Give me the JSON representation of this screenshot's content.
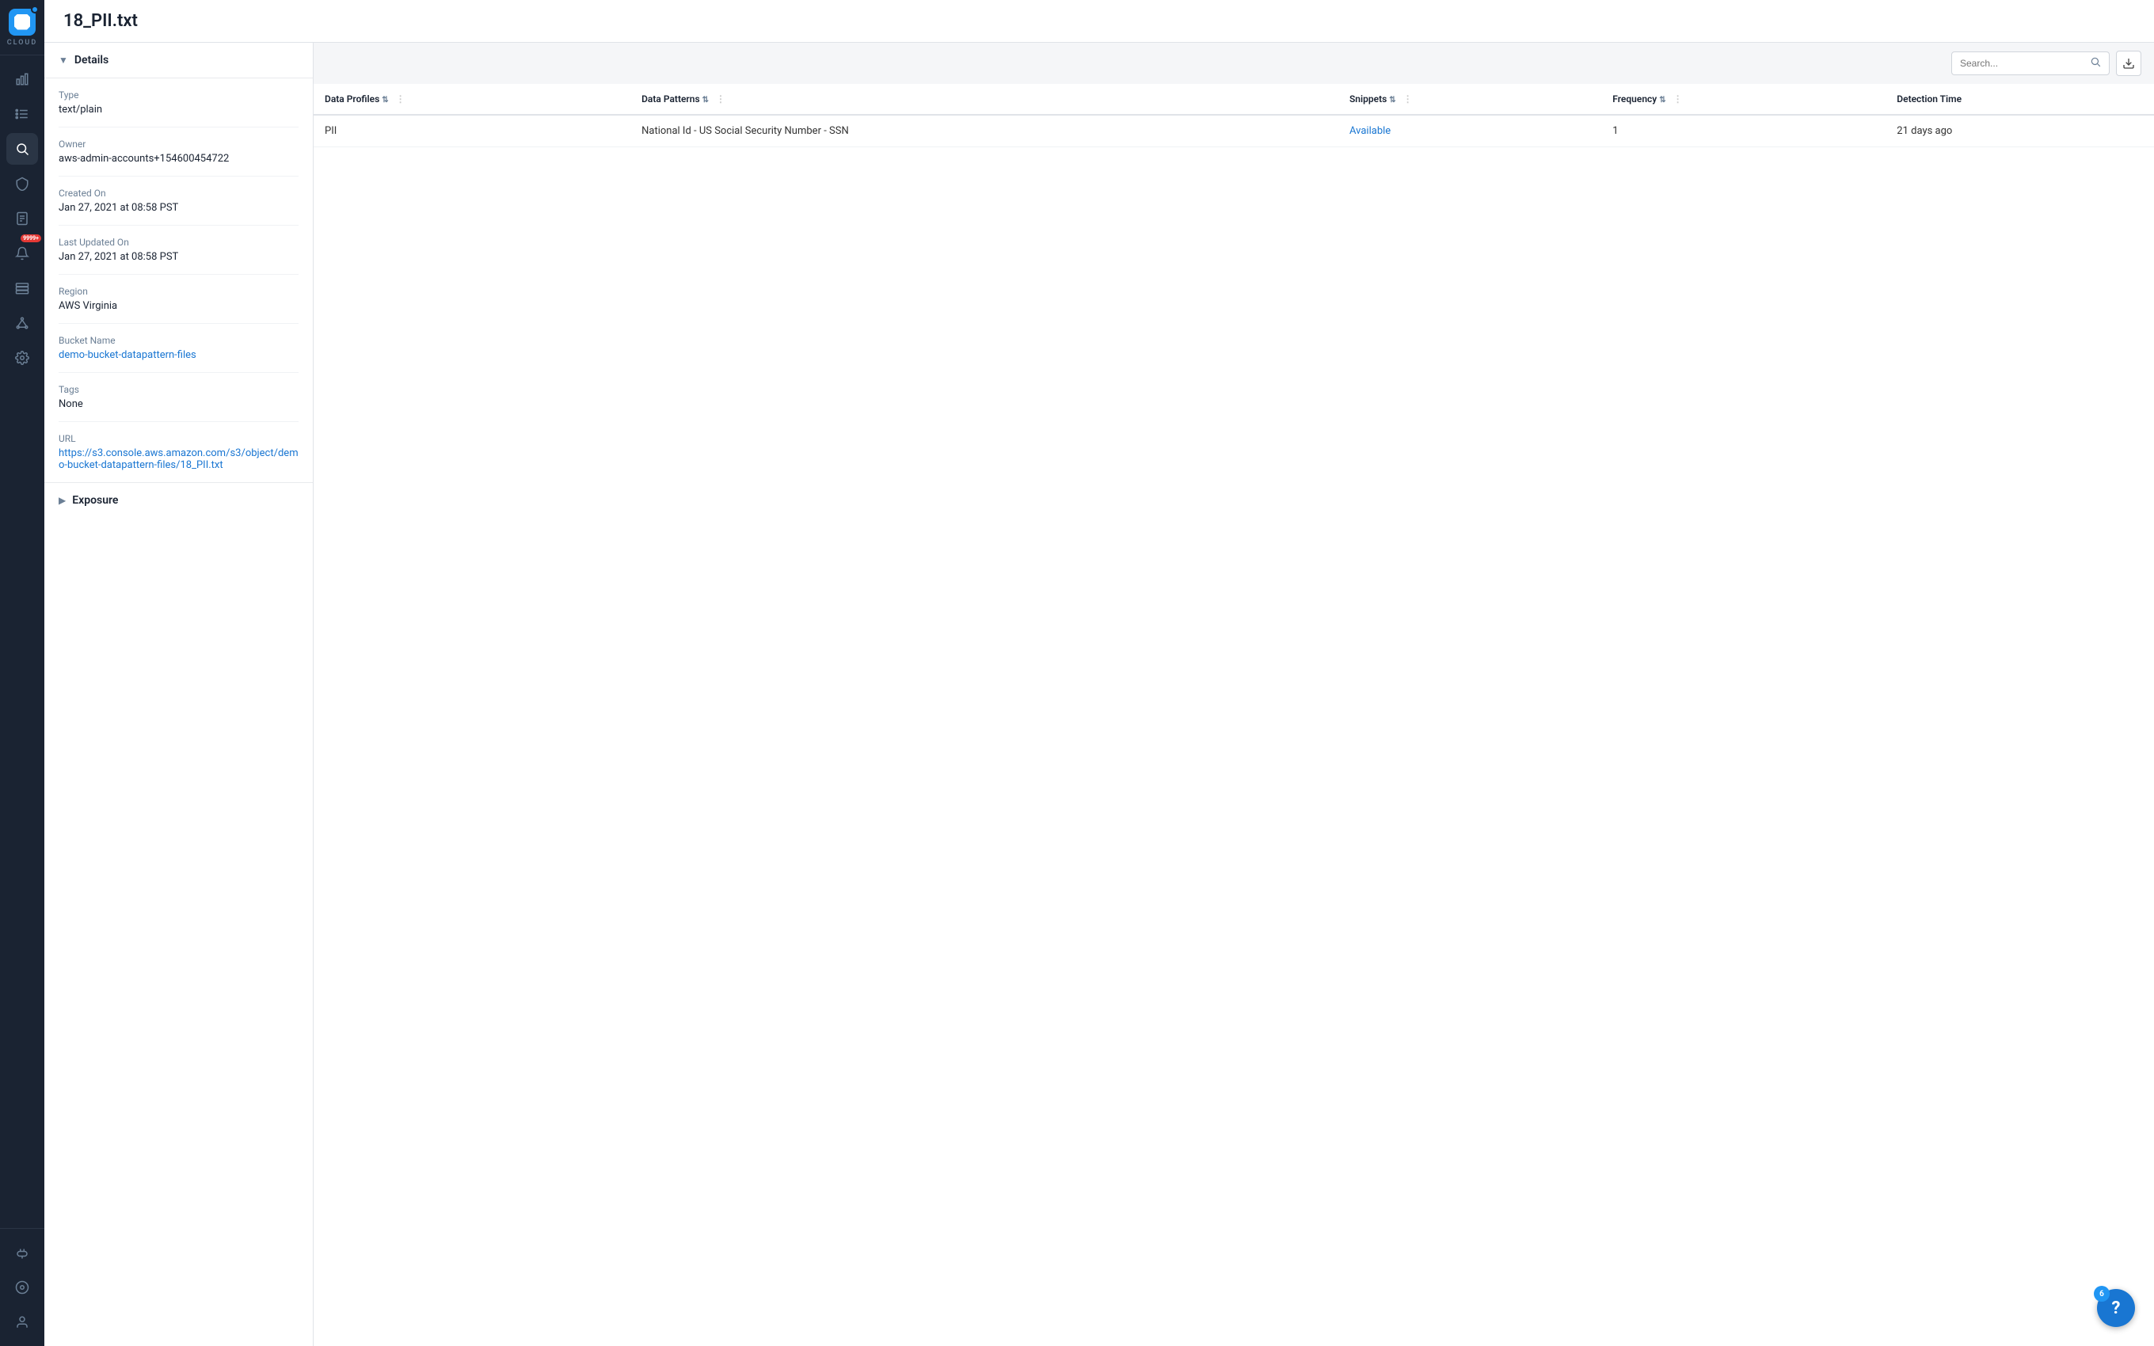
{
  "app": {
    "title": "18_PII.txt",
    "cloud_label": "CLOUD"
  },
  "sidebar": {
    "nav_items": [
      {
        "id": "dashboard",
        "icon": "chart",
        "label": "Dashboard"
      },
      {
        "id": "inventory",
        "icon": "list",
        "label": "Inventory"
      },
      {
        "id": "search",
        "icon": "search",
        "label": "Search"
      },
      {
        "id": "shield",
        "icon": "shield",
        "label": "Security"
      },
      {
        "id": "reports",
        "icon": "document",
        "label": "Reports"
      },
      {
        "id": "alerts",
        "icon": "bell",
        "label": "Alerts",
        "badge": "9999+"
      },
      {
        "id": "storage",
        "icon": "storage",
        "label": "Storage"
      },
      {
        "id": "topology",
        "icon": "topology",
        "label": "Topology"
      },
      {
        "id": "settings",
        "icon": "gear",
        "label": "Settings"
      }
    ],
    "bottom_items": [
      {
        "id": "integrations",
        "icon": "plug",
        "label": "Integrations"
      },
      {
        "id": "monitoring",
        "icon": "eye-circle",
        "label": "Monitoring"
      },
      {
        "id": "user",
        "icon": "user",
        "label": "User"
      }
    ]
  },
  "details": {
    "section_label": "Details",
    "fields": [
      {
        "label": "Type",
        "value": "text/plain",
        "type": "text"
      },
      {
        "label": "Owner",
        "value": "aws-admin-accounts+154600454722",
        "type": "text"
      },
      {
        "label": "Created On",
        "value": "Jan 27, 2021 at 08:58 PST",
        "type": "text"
      },
      {
        "label": "Last Updated On",
        "value": "Jan 27, 2021 at 08:58 PST",
        "type": "text"
      },
      {
        "label": "Region",
        "value": "AWS Virginia",
        "type": "text"
      },
      {
        "label": "Bucket Name",
        "value": "demo-bucket-datapattern-files",
        "type": "link"
      },
      {
        "label": "Tags",
        "value": "None",
        "type": "text"
      },
      {
        "label": "URL",
        "value": "https://s3.console.aws.amazon.com/s3/object/demo-bucket-datapattern-files/18_PII.txt",
        "type": "link"
      }
    ],
    "exposure_label": "Exposure"
  },
  "table": {
    "search_placeholder": "Search...",
    "columns": [
      {
        "label": "Data Profiles",
        "id": "data_profiles"
      },
      {
        "label": "Data Patterns",
        "id": "data_patterns"
      },
      {
        "label": "Snippets",
        "id": "snippets"
      },
      {
        "label": "Frequency",
        "id": "frequency"
      },
      {
        "label": "Detection Time",
        "id": "detection_time"
      }
    ],
    "rows": [
      {
        "data_profile": "PII",
        "data_pattern": "National Id - US Social Security Number - SSN",
        "snippets": "Available",
        "frequency": "1",
        "detection_time": "21 days ago"
      }
    ]
  },
  "help": {
    "badge": "6",
    "label": "?"
  }
}
